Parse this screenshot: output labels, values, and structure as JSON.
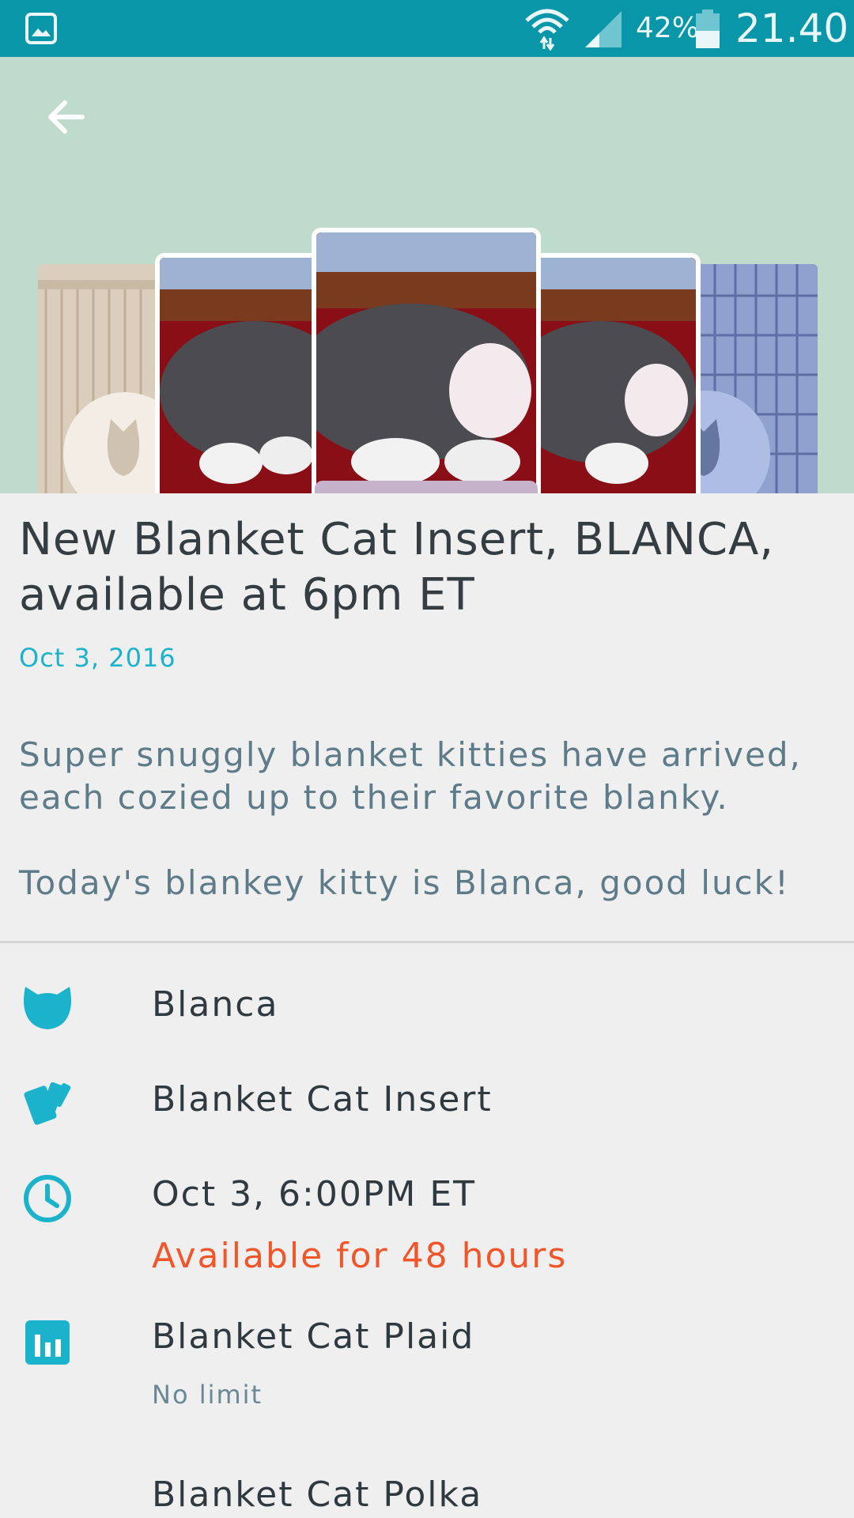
{
  "status_bar": {
    "battery_percent": "42%",
    "time": "21.40",
    "icons": [
      "gallery-icon",
      "wifi-icon",
      "signal-icon",
      "battery-icon"
    ]
  },
  "header": {
    "back_icon": "back-arrow-icon"
  },
  "post": {
    "title": "New Blanket Cat Insert, BLANCA, available at 6pm ET",
    "date": "Oct 3, 2016",
    "description_1": "Super snuggly blanket kitties have arrived, each cozied up to their favorite blanky.",
    "description_2": "Today's blankey kitty is Blanca, good luck!"
  },
  "details": {
    "cat_name": "Blanca",
    "item_type": "Blanket Cat Insert",
    "release_time": "Oct 3, 6:00PM ET",
    "availability": "Available for 48 hours",
    "plaid_name": "Blanket Cat Plaid",
    "plaid_limit": "No limit",
    "polka_name": "Blanket Cat Polka"
  },
  "colors": {
    "status_bar": "#0996a8",
    "hero_bg": "#bfdbcc",
    "accent": "#1bb2cc",
    "availability": "#f0562a"
  }
}
